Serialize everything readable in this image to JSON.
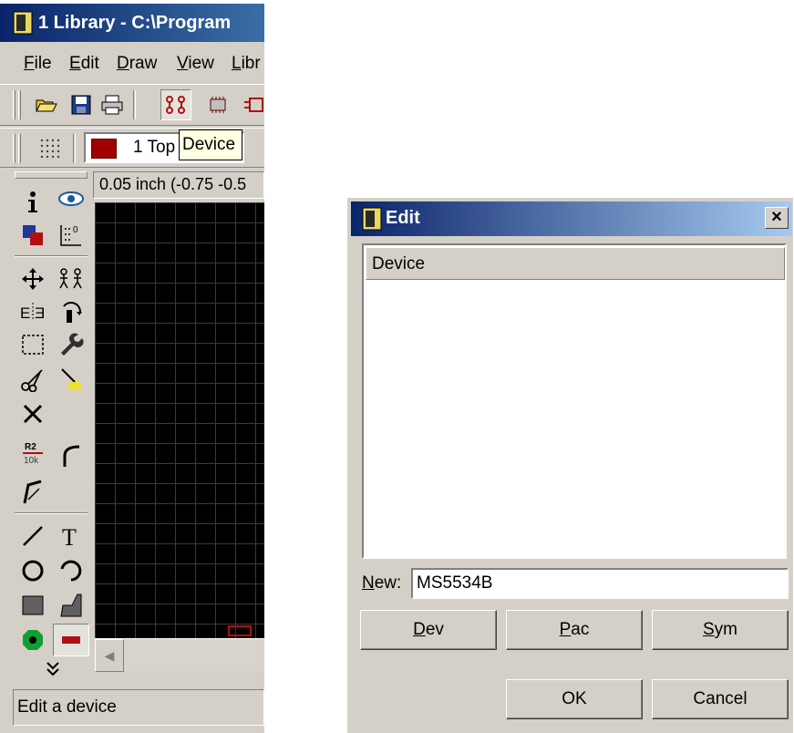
{
  "main_window": {
    "title": "1 Library - C:\\Program",
    "menu": [
      "File",
      "Edit",
      "Draw",
      "View",
      "Libr"
    ],
    "layer_combo": {
      "swatch_color": "#a00000",
      "text": "1 Top"
    },
    "tooltip": "Device",
    "coord_display": "0.05 inch (-0.75 -0.5",
    "status_text": "Edit a device",
    "toolbar_icons": [
      "open-folder-icon",
      "save-disk-icon",
      "print-icon",
      "device-icon",
      "package-icon",
      "symbol-icon"
    ],
    "tool_icons": [
      "info-icon",
      "show-eye-icon",
      "display-layers-icon",
      "mark-icon",
      "move-icon",
      "copy-icon",
      "mirror-icon",
      "rotate-icon",
      "group-icon",
      "change-wrench-icon",
      "cut-scissors-icon",
      "paste-icon",
      "delete-icon",
      "name-value-icon",
      "miter-icon",
      "split-icon",
      "wire-icon",
      "text-icon",
      "circle-icon",
      "arc-icon",
      "rect-icon",
      "polygon-icon",
      "pad-icon",
      "smd-icon",
      "more-chevron-icon"
    ]
  },
  "edit_dialog": {
    "title": "Edit",
    "close_label": "×",
    "list_header": "Device",
    "list_items": [],
    "new_label": "New:",
    "new_value": "MS5534B",
    "buttons": {
      "dev": "Dev",
      "pac": "Pac",
      "sym": "Sym",
      "ok": "OK",
      "cancel": "Cancel"
    }
  }
}
